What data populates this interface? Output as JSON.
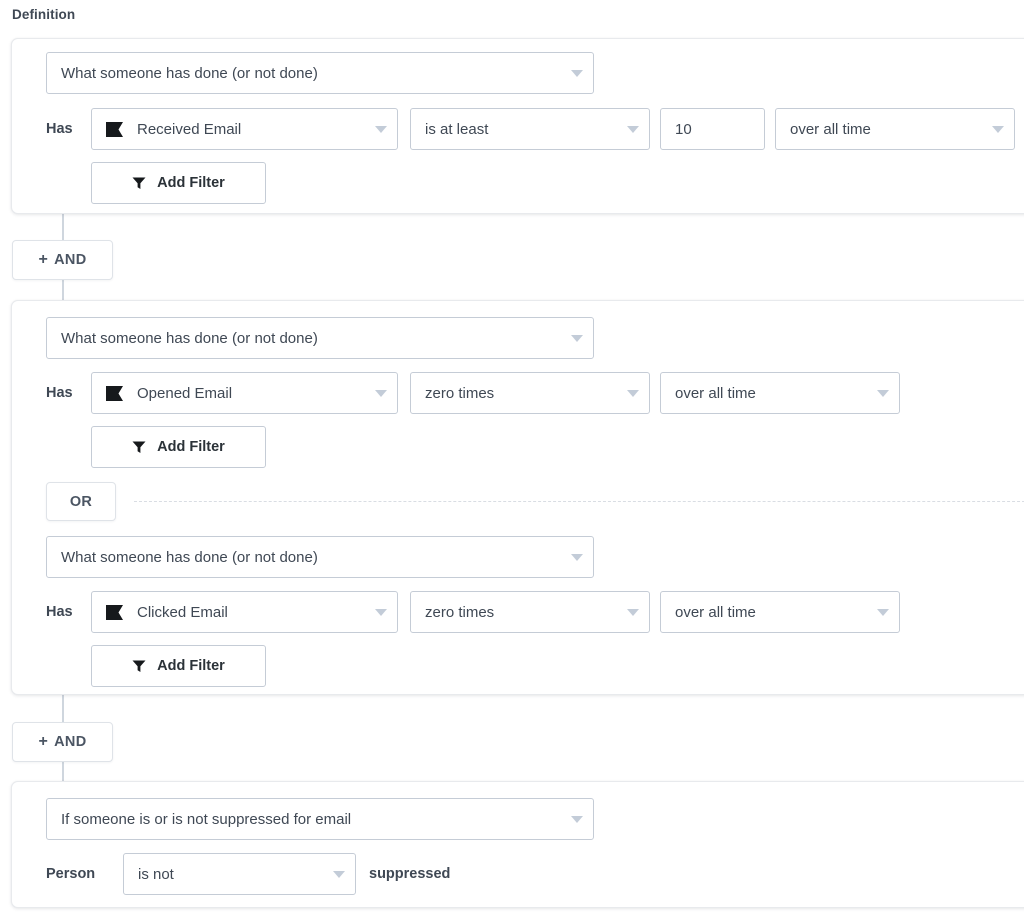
{
  "page": {
    "section_label": "Definition"
  },
  "colors": {
    "text": "#3f4854",
    "border": "#c5ccd6",
    "card_border": "#e8eaed",
    "caret": "#c3ccd8",
    "connector": "#cfd6de"
  },
  "groups": [
    {
      "id": "group-1",
      "rows": [
        {
          "type_select": "What someone has done (or not done)",
          "prefix_label": "Has",
          "metric_select": "Received Email",
          "metric_icon": "flag-icon",
          "operator_select": "is at least",
          "count_value": "10",
          "timeframe_select": "over all time",
          "add_filter_label": "Add Filter",
          "add_filter_icon": "funnel-icon"
        }
      ]
    },
    {
      "id": "group-2",
      "rows": [
        {
          "type_select": "What someone has done (or not done)",
          "prefix_label": "Has",
          "metric_select": "Opened Email",
          "metric_icon": "flag-icon",
          "operator_select": "zero times",
          "timeframe_select": "over all time",
          "add_filter_label": "Add Filter",
          "add_filter_icon": "funnel-icon"
        },
        {
          "type_select": "What someone has done (or not done)",
          "prefix_label": "Has",
          "metric_select": "Clicked Email",
          "metric_icon": "flag-icon",
          "operator_select": "zero times",
          "timeframe_select": "over all time",
          "add_filter_label": "Add Filter",
          "add_filter_icon": "funnel-icon"
        }
      ],
      "or_label": "OR"
    },
    {
      "id": "group-3",
      "rows": [
        {
          "type_select": "If someone is or is not suppressed for email",
          "prefix_label": "Person",
          "operator_select": "is not",
          "suffix_label": "suppressed"
        }
      ]
    }
  ],
  "and_buttons": [
    {
      "plus": "+",
      "label": "AND"
    },
    {
      "plus": "+",
      "label": "AND"
    }
  ]
}
